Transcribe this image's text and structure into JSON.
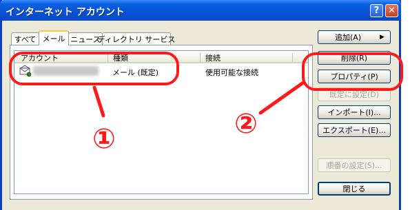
{
  "window": {
    "title": "インターネット アカウント",
    "help_glyph": "?",
    "close_glyph": "✕"
  },
  "tabs": [
    {
      "label": "すべて",
      "active": false
    },
    {
      "label": "メール",
      "active": true
    },
    {
      "label": "ニュース",
      "active": false
    },
    {
      "label": "ディレクトリ サービス",
      "active": false
    }
  ],
  "list": {
    "columns": [
      "アカウント",
      "種類",
      "接続"
    ],
    "rows": [
      {
        "account": "",
        "type": "メール (既定)",
        "connection": "使用可能な接続"
      }
    ]
  },
  "buttons": {
    "add": "追加(A)",
    "add_arrow": "▶",
    "remove": "削除(R)",
    "properties": "プロパティ(P)",
    "set_default": "既定に設定(D)",
    "import": "インポート(I)...",
    "export": "エクスポート(E)...",
    "order": "順番の設定(S)...",
    "close": "閉じる"
  },
  "annotations": {
    "one": "①",
    "two": "②",
    "color": "#ff1a1a"
  },
  "colors": {
    "titlebar": "#0653d6",
    "dialog_bg": "#ece9d8"
  }
}
